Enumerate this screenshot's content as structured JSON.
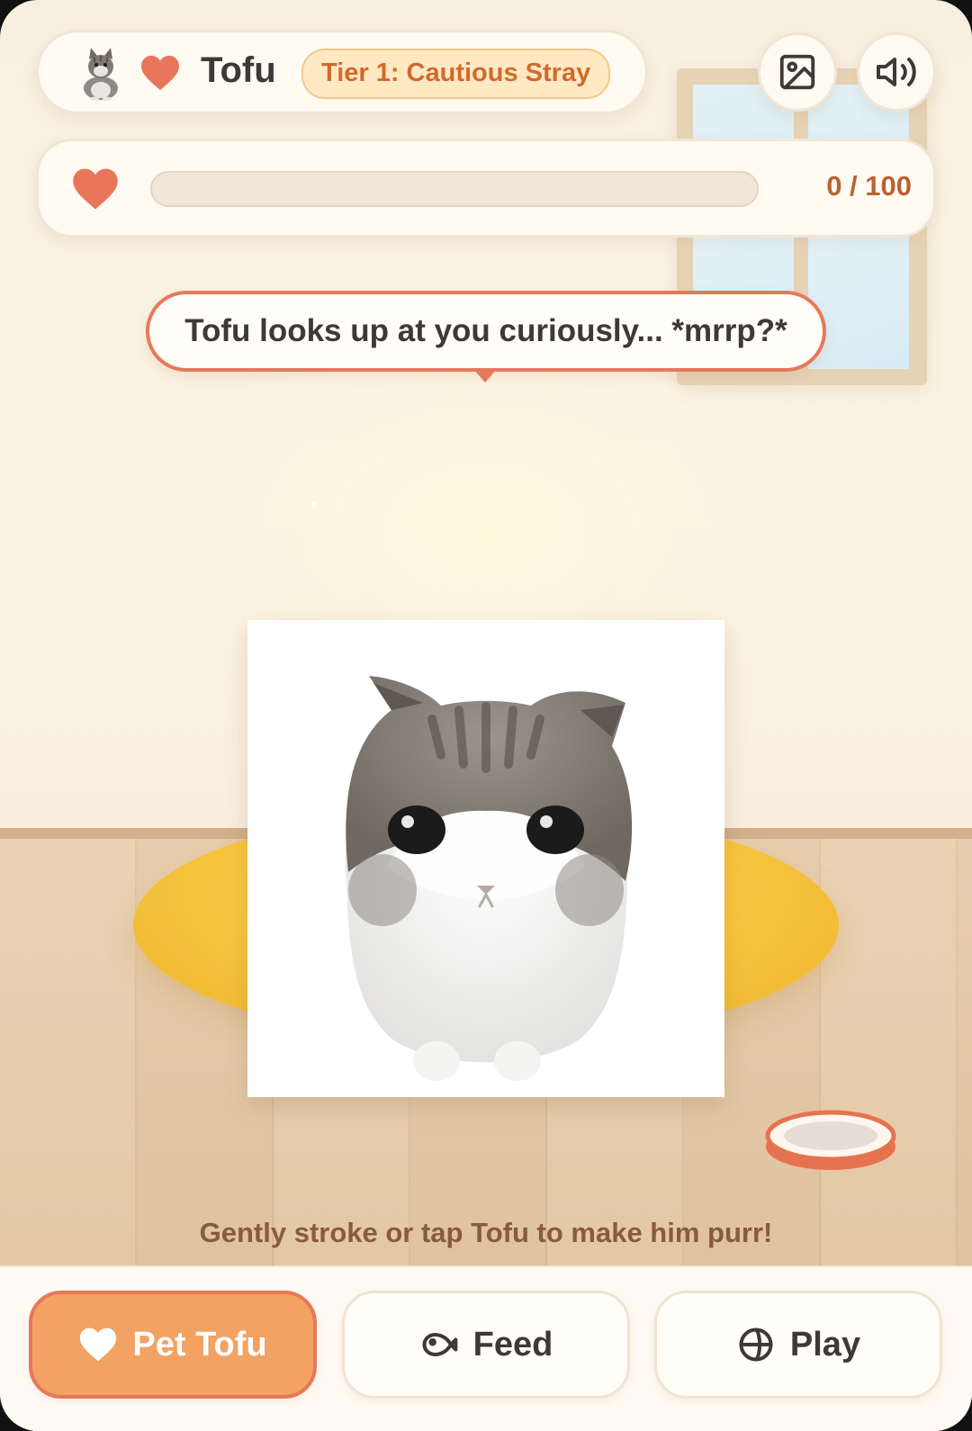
{
  "header": {
    "pet_name": "Tofu",
    "tier_badge": "Tier 1: Cautious Stray",
    "avatar_icon": "cat-avatar-icon",
    "heart_icon": "heart-icon",
    "gallery_button_icon": "image-icon",
    "sound_button_icon": "speaker-icon"
  },
  "affection": {
    "value": 0,
    "max": 100,
    "label": "0 / 100"
  },
  "speech_bubble": {
    "text": "Tofu looks up at you curiously... *mrrp?*"
  },
  "hint": "Gently stroke or tap Tofu to make him purr!",
  "actions": [
    {
      "label": "Pet Tofu",
      "icon": "heart-icon",
      "active": true
    },
    {
      "label": "Feed",
      "icon": "fish-icon",
      "active": false
    },
    {
      "label": "Play",
      "icon": "ball-icon",
      "active": false
    }
  ],
  "colors": {
    "accent": "#f2a263",
    "accent_border": "#e8775a",
    "heart": "#e8775a",
    "badge_text": "#d06a2c",
    "cushion": "#f6c43c"
  }
}
